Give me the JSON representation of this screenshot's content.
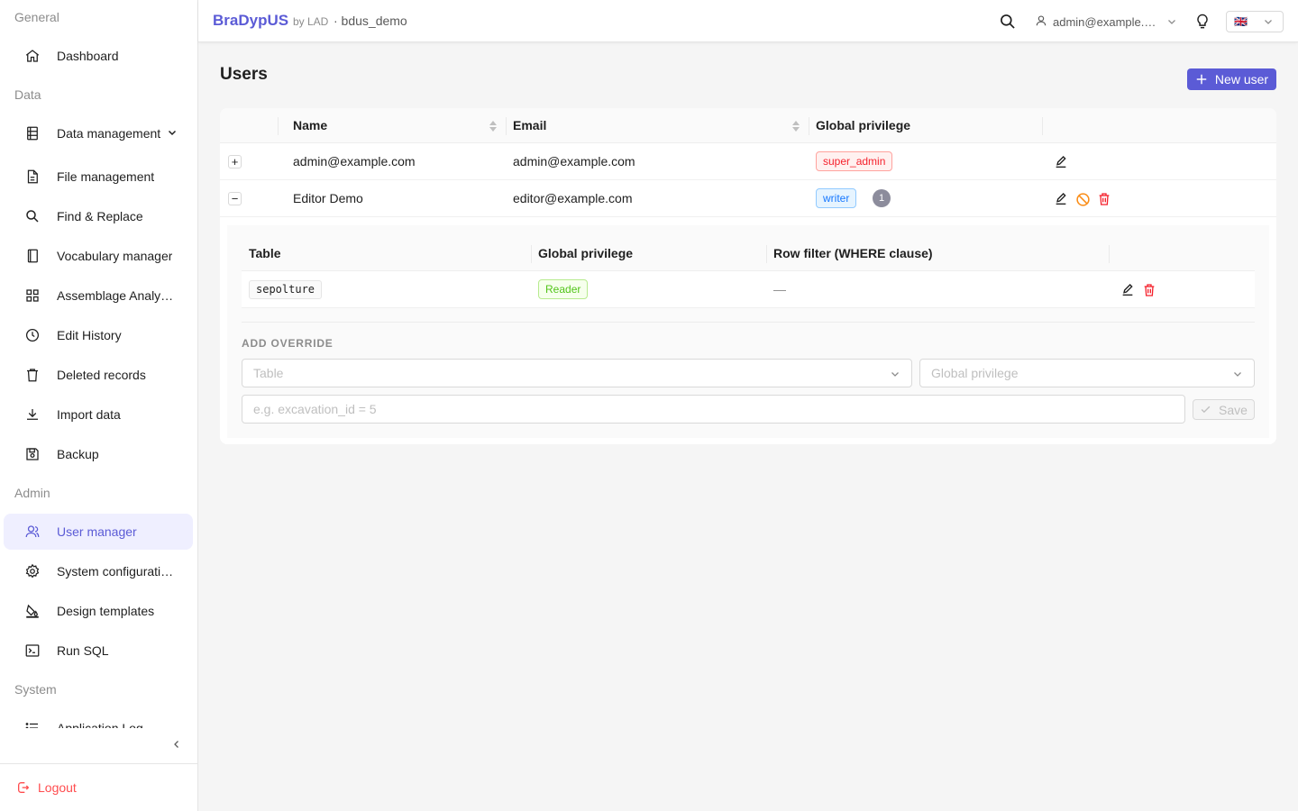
{
  "sidebar": {
    "groups": {
      "general": "General",
      "data": "Data",
      "admin": "Admin",
      "system": "System"
    },
    "items": {
      "dashboard": "Dashboard",
      "data_management": "Data management",
      "file_management": "File management",
      "find_replace": "Find & Replace",
      "vocabulary_manager": "Vocabulary manager",
      "assemblage_analysis": "Assemblage Analy…",
      "edit_history": "Edit History",
      "deleted_records": "Deleted records",
      "import_data": "Import data",
      "backup": "Backup",
      "user_manager": "User manager",
      "system_configuration": "System configurati…",
      "design_templates": "Design templates",
      "run_sql": "Run SQL",
      "application_log": "Application Log"
    },
    "logout": "Logout"
  },
  "header": {
    "brand": "BraDypUS",
    "brand_by": "by LAD",
    "app_name": "· bdus_demo",
    "user": "admin@example.com",
    "language_flag": "🇬🇧"
  },
  "main": {
    "title": "Users",
    "new_user_label": "New user",
    "columns": {
      "name": "Name",
      "email": "Email",
      "privilege": "Global privilege"
    },
    "rows": [
      {
        "name": "admin@example.com",
        "email": "admin@example.com",
        "privilege": "super_admin",
        "expand": "+"
      },
      {
        "name": "Editor Demo",
        "email": "editor@example.com",
        "privilege": "writer",
        "override_count": "1",
        "expand": "−"
      }
    ],
    "overrides": {
      "columns": {
        "table": "Table",
        "privilege": "Global privilege",
        "filter": "Row filter (WHERE clause)"
      },
      "rows": [
        {
          "table": "sepolture",
          "privilege": "Reader",
          "filter": "—"
        }
      ],
      "add_title": "ADD OVERRIDE",
      "table_placeholder": "Table",
      "privilege_placeholder": "Global privilege",
      "where_placeholder": "e.g. excavation_id = 5",
      "save_label": "Save"
    }
  },
  "colors": {
    "accent": "#5b5bd6",
    "danger": "#f5222d",
    "warning": "#fa8c16",
    "active_bg": "#efefff"
  }
}
